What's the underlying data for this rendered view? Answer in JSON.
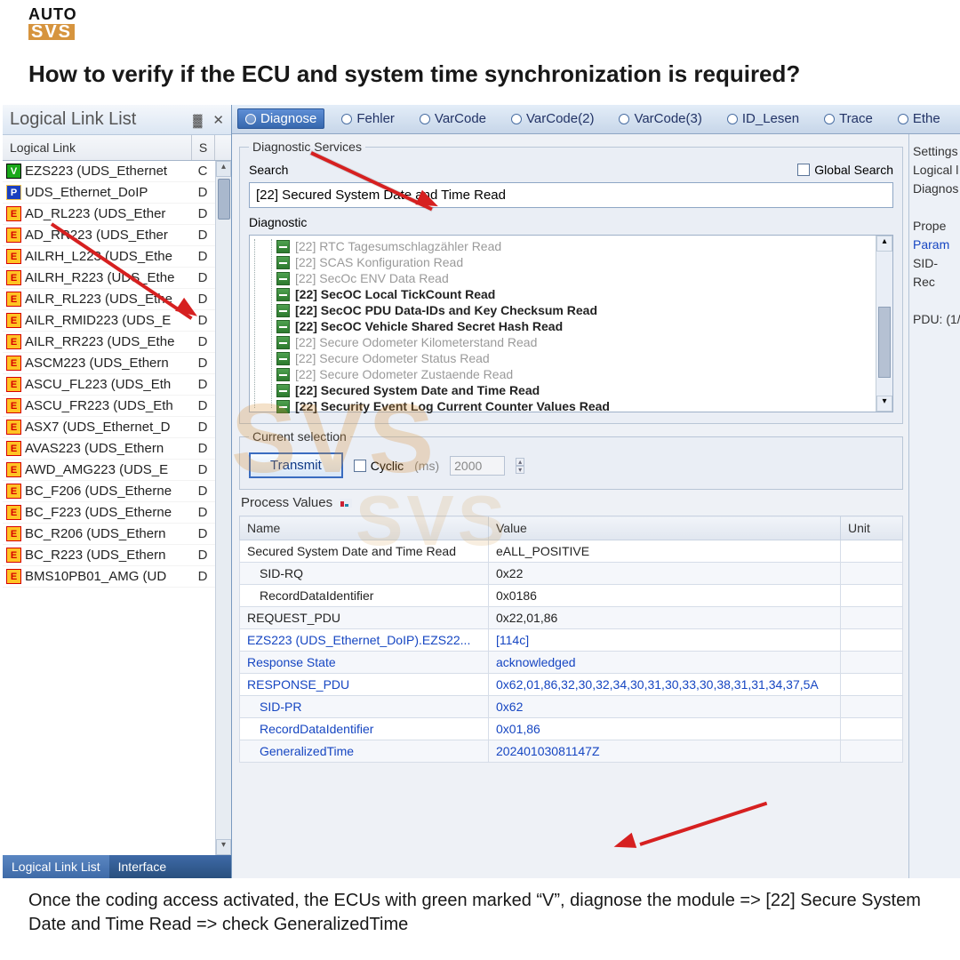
{
  "logo": {
    "l1": "AUTO",
    "l2": "SVS"
  },
  "page_title": "How to verify if the ECU and system time synchronization is required?",
  "caption": "Once the coding access activated, the ECUs with green marked “V”, diagnose the module => [22] Secure System Date and Time Read => check GeneralizedTime",
  "sidebar": {
    "title": "Logical Link List",
    "header_col1": "Logical Link",
    "header_col2": "S",
    "pin_glyph": "▓",
    "close_glyph": "✕",
    "items": [
      {
        "badge": "V",
        "cls": "green",
        "text": "EZS223 (UDS_Ethernet",
        "s": "C",
        "arrow": "^"
      },
      {
        "badge": "P",
        "cls": "blue",
        "text": "UDS_Ethernet_DoIP",
        "s": "D"
      },
      {
        "badge": "E",
        "cls": "yellow",
        "text": "AD_RL223 (UDS_Ether",
        "s": "D"
      },
      {
        "badge": "E",
        "cls": "yellow",
        "text": "AD_RR223 (UDS_Ether",
        "s": "D"
      },
      {
        "badge": "E",
        "cls": "yellow",
        "text": "AILRH_L223 (UDS_Ethe",
        "s": "D"
      },
      {
        "badge": "E",
        "cls": "yellow",
        "text": "AILRH_R223 (UDS_Ethe",
        "s": "D"
      },
      {
        "badge": "E",
        "cls": "yellow",
        "text": "AILR_RL223 (UDS_Ethe",
        "s": "D"
      },
      {
        "badge": "E",
        "cls": "yellow",
        "text": "AILR_RMID223 (UDS_E",
        "s": "D"
      },
      {
        "badge": "E",
        "cls": "yellow",
        "text": "AILR_RR223 (UDS_Ethe",
        "s": "D"
      },
      {
        "badge": "E",
        "cls": "yellow",
        "text": "ASCM223 (UDS_Ethern",
        "s": "D"
      },
      {
        "badge": "E",
        "cls": "yellow",
        "text": "ASCU_FL223 (UDS_Eth",
        "s": "D"
      },
      {
        "badge": "E",
        "cls": "yellow",
        "text": "ASCU_FR223 (UDS_Eth",
        "s": "D"
      },
      {
        "badge": "E",
        "cls": "yellow",
        "text": "ASX7 (UDS_Ethernet_D",
        "s": "D"
      },
      {
        "badge": "E",
        "cls": "yellow",
        "text": "AVAS223 (UDS_Ethern",
        "s": "D"
      },
      {
        "badge": "E",
        "cls": "yellow",
        "text": "AWD_AMG223 (UDS_E",
        "s": "D"
      },
      {
        "badge": "E",
        "cls": "yellow",
        "text": "BC_F206 (UDS_Etherne",
        "s": "D"
      },
      {
        "badge": "E",
        "cls": "yellow",
        "text": "BC_F223 (UDS_Etherne",
        "s": "D"
      },
      {
        "badge": "E",
        "cls": "yellow",
        "text": "BC_R206 (UDS_Ethern",
        "s": "D"
      },
      {
        "badge": "E",
        "cls": "yellow",
        "text": "BC_R223 (UDS_Ethern",
        "s": "D"
      },
      {
        "badge": "E",
        "cls": "yellow",
        "text": "BMS10PB01_AMG (UD",
        "s": "D",
        "arrow": "v"
      }
    ],
    "bottom_tabs": [
      "Logical Link List",
      "Interface"
    ]
  },
  "topbar": {
    "tabs": [
      "Diagnose",
      "Fehler",
      "VarCode",
      "VarCode(2)",
      "VarCode(3)",
      "ID_Lesen",
      "Trace",
      "Ethe"
    ],
    "active_index": 0
  },
  "services": {
    "legend": "Diagnostic Services",
    "search_label": "Search",
    "global_search": "Global Search",
    "search_value": "[22] Secured System Date and Time Read",
    "diag_label": "Diagnostic",
    "tree": [
      {
        "type": "grey",
        "text": "[22] RTC Tagesumschlagzähler Read"
      },
      {
        "type": "grey",
        "text": "[22] SCAS Konfiguration Read"
      },
      {
        "type": "grey",
        "text": "[22] SecOc ENV Data Read"
      },
      {
        "type": "bold",
        "text": "[22] SecOC Local TickCount Read"
      },
      {
        "type": "bold",
        "text": "[22] SecOC PDU Data-IDs and Key Checksum Read"
      },
      {
        "type": "bold",
        "text": "[22] SecOC Vehicle Shared Secret Hash Read"
      },
      {
        "type": "grey",
        "text": "[22] Secure Odometer Kilometerstand Read"
      },
      {
        "type": "grey",
        "text": "[22] Secure Odometer Status Read"
      },
      {
        "type": "grey",
        "text": "[22] Secure Odometer Zustaende Read"
      },
      {
        "type": "bold",
        "text": "[22] Secured System Date and Time Read"
      },
      {
        "type": "bold",
        "text": "[22] Security Event Log Current Counter Values Read"
      }
    ]
  },
  "current_selection": {
    "legend": "Current selection",
    "transmit": "Transmit",
    "cyclic": "Cyclic",
    "ms": "(ms)",
    "interval": "2000"
  },
  "process": {
    "title": "Process Values",
    "headers": [
      "Name",
      "Value",
      "Unit"
    ],
    "rows": [
      {
        "cls": "",
        "name": "Secured System Date and Time Read",
        "value": "eALL_POSITIVE",
        "unit": ""
      },
      {
        "cls": "indent alt",
        "name": "SID-RQ",
        "value": "0x22",
        "unit": ""
      },
      {
        "cls": "indent",
        "name": "RecordDataIdentifier",
        "value": "0x0186",
        "unit": ""
      },
      {
        "cls": "alt",
        "name": "REQUEST_PDU",
        "value": "0x22,01,86",
        "unit": ""
      },
      {
        "cls": "blue",
        "name": "EZS223 (UDS_Ethernet_DoIP).EZS22...",
        "value": "[114c]",
        "unit": ""
      },
      {
        "cls": "blue alt",
        "name": "Response State",
        "value": "acknowledged",
        "unit": ""
      },
      {
        "cls": "blue",
        "name": "RESPONSE_PDU",
        "value": "0x62,01,86,32,30,32,34,30,31,30,33,30,38,31,31,34,37,5A",
        "unit": ""
      },
      {
        "cls": "blue indent alt",
        "name": "SID-PR",
        "value": "0x62",
        "unit": ""
      },
      {
        "cls": "blue indent",
        "name": "RecordDataIdentifier",
        "value": "0x01,86",
        "unit": ""
      },
      {
        "cls": "blue indent alt",
        "name": "GeneralizedTime",
        "value": "20240103081147Z",
        "unit": ""
      }
    ]
  },
  "right_strip": {
    "items": [
      {
        "cls": "",
        "text": "Settings"
      },
      {
        "cls": "",
        "text": "Logical l"
      },
      {
        "cls": "",
        "text": "Diagnos"
      },
      {
        "cls": "",
        "text": " "
      },
      {
        "cls": "",
        "text": "Prope"
      },
      {
        "cls": "link",
        "text": "Param"
      },
      {
        "cls": "",
        "text": "SID-"
      },
      {
        "cls": "",
        "text": "Rec"
      },
      {
        "cls": "",
        "text": " "
      },
      {
        "cls": "",
        "text": "PDU: (1/"
      }
    ]
  }
}
